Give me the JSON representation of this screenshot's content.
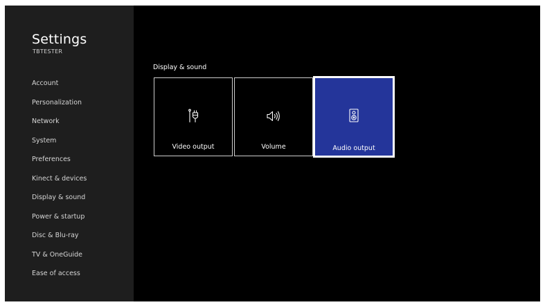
{
  "app": {
    "title": "Settings",
    "user": "TBTESTER"
  },
  "sidebar": {
    "items": [
      {
        "label": "Account"
      },
      {
        "label": "Personalization"
      },
      {
        "label": "Network"
      },
      {
        "label": "System"
      },
      {
        "label": "Preferences"
      },
      {
        "label": "Kinect & devices"
      },
      {
        "label": "Display & sound"
      },
      {
        "label": "Power & startup"
      },
      {
        "label": "Disc & Blu-ray"
      },
      {
        "label": "TV & OneGuide"
      },
      {
        "label": "Ease of access"
      }
    ]
  },
  "main": {
    "section_title": "Display & sound",
    "tiles": [
      {
        "label": "Video output",
        "icon": "video-plug-icon"
      },
      {
        "label": "Volume",
        "icon": "speaker-volume-icon"
      },
      {
        "label": "Audio output",
        "icon": "audio-speaker-icon",
        "focused": true
      }
    ]
  },
  "colors": {
    "sidebar_bg": "#1e1e1e",
    "screen_bg": "#000000",
    "focus_tile_bg": "#24359a",
    "focus_border": "#ffffff"
  }
}
